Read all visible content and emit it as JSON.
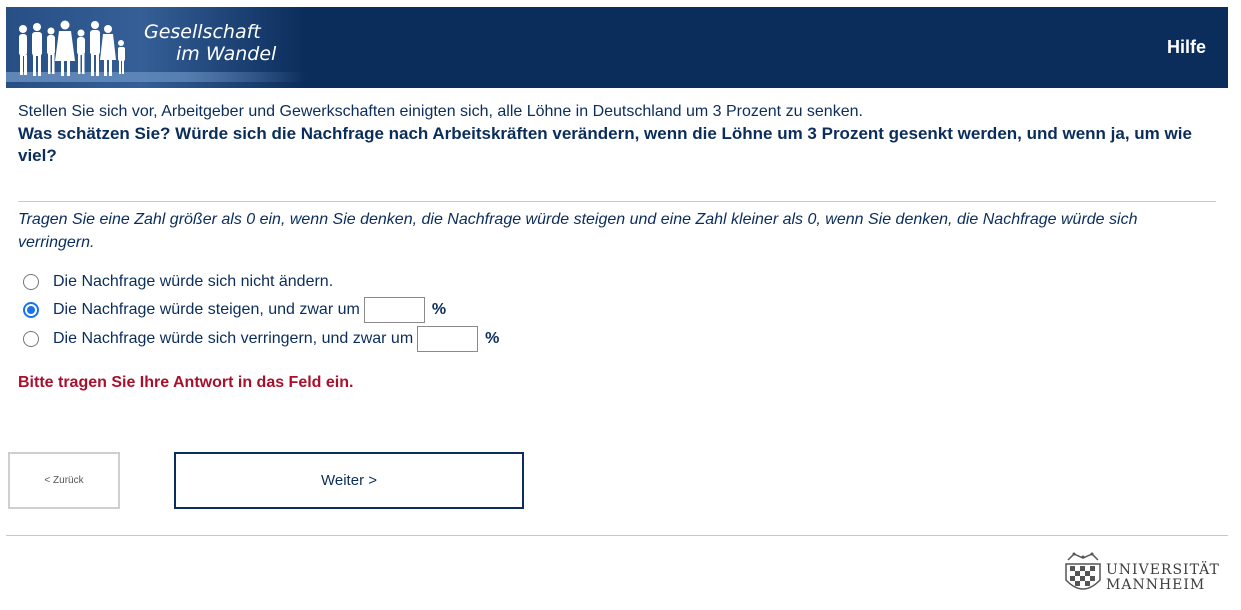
{
  "header": {
    "logo_line1": "Gesellschaft",
    "logo_line2": "im Wandel",
    "help_label": "Hilfe",
    "bg_color": "#0b2d5c"
  },
  "question": {
    "intro": "Stellen Sie sich vor, Arbeitgeber und Gewerkschaften einigten sich, alle Löhne in Deutschland um 3 Prozent zu senken.",
    "bold": "Was schätzen Sie? Würde sich die Nachfrage nach Arbeitskräften verändern, wenn die Löhne um 3 Prozent gesenkt werden, und wenn ja, um wie viel?"
  },
  "instruction": "Tragen Sie eine Zahl größer als 0 ein, wenn Sie denken, die Nachfrage würde steigen und eine Zahl kleiner als 0, wenn Sie denken, die Nachfrage würde sich verringern.",
  "options": [
    {
      "label": "Die Nachfrage würde sich nicht ändern.",
      "checked": false
    },
    {
      "label": "Die Nachfrage würde steigen, und zwar um",
      "checked": true,
      "input_value": "",
      "unit": "%"
    },
    {
      "label": "Die Nachfrage würde sich verringern, und zwar um",
      "checked": false,
      "input_value": "",
      "unit": "%"
    }
  ],
  "error_message": "Bitte tragen Sie Ihre Antwort in das Feld ein.",
  "error_color": "#a8102c",
  "nav": {
    "back_label": "< Zurück",
    "next_label": "Weiter >"
  },
  "footer": {
    "uni_line1": "UNIVERSITÄT",
    "uni_line2": "MANNHEIM"
  }
}
